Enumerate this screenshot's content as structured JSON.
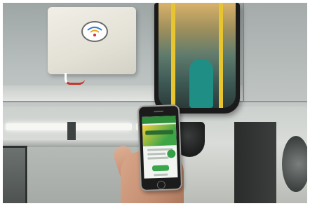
{
  "scene": {
    "wifi_logo_mark": "wifi-router-logo",
    "colors": {
      "ceiling": "#b7bebd",
      "wifi_box": "#ebe9df",
      "mirror_frame": "#1a1a1a",
      "phone_screen_green": "#3aa64b",
      "phone_screen_yellow": "#f4d23b",
      "cable_red": "#c0392b"
    }
  }
}
